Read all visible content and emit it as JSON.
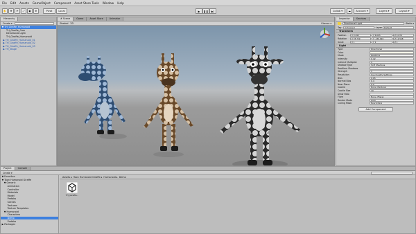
{
  "menu": [
    "File",
    "Edit",
    "Assets",
    "GameObject",
    "Component",
    "Asset Store Tools",
    "Window",
    "Help"
  ],
  "toolbar": {
    "pivot": "Pivot",
    "local": "Local",
    "play": "▶",
    "pause": "❚❚",
    "step": "▶|",
    "collab": "Collab ▾",
    "account": "Account ▾",
    "layers": "Layers ▾",
    "layout": "Layout ▾"
  },
  "hierarchy": {
    "tab": "Hierarchy",
    "create": "Create ▾",
    "rows": [
      {
        "text": "▼ TH_Giraffe_Humanoid",
        "indent": 1,
        "style": "sel"
      },
      {
        "text": "TH_Giraffe_Cam",
        "indent": 5,
        "style": ""
      },
      {
        "text": "Directional Light",
        "indent": 5,
        "style": ""
      },
      {
        "text": "TH_Giraffe_Humanoid",
        "indent": 5,
        "style": ""
      },
      {
        "text": "▶ TH_Giraffe_Humanoid_01",
        "indent": 2,
        "style": "blue"
      },
      {
        "text": "▶ TH_Giraffe_Humanoid_02",
        "indent": 2,
        "style": "blue"
      },
      {
        "text": "▶ TH_Giraffe_Humanoid_03",
        "indent": 2,
        "style": "blue"
      },
      {
        "text": "▶ TH_Stage",
        "indent": 2,
        "style": "blue"
      }
    ]
  },
  "scene": {
    "tabs": [
      "# Scene",
      "Game",
      "Asset Store",
      "Animator"
    ],
    "shaded": "Shaded",
    "mode_2d": "2D",
    "gizmos": "Gizmos ▾"
  },
  "inspector": {
    "tabs": [
      "Inspector",
      "Services"
    ],
    "object_name": "Directional Light",
    "static": "Static ▾",
    "tag": "Untagged",
    "layer": "Default",
    "transform_header": "Transform",
    "position": [
      "X 9.495",
      "Y 6.095",
      "Z 4.879"
    ],
    "rotation": [
      "X 35.729",
      "Y -130.094",
      "Z 12.548"
    ],
    "scale": [
      "X 1",
      "Y 1",
      "Z 1"
    ],
    "light_header": "Light",
    "rows": [
      {
        "label": "Type",
        "value": "Directional"
      },
      {
        "label": "Color",
        "value": ""
      },
      {
        "label": "Mode",
        "value": "Realtime"
      },
      {
        "label": "Intensity",
        "value": "0.42"
      },
      {
        "label": "Indirect Multiplier",
        "value": "1"
      },
      {
        "label": "Shadow Type",
        "value": "Soft Shadows"
      },
      {
        "label": "Realtime Shadows",
        "value": ""
      },
      {
        "label": "Strength",
        "value": "1"
      },
      {
        "label": "Resolution",
        "value": "Use Quality Settings"
      },
      {
        "label": "Bias",
        "value": "0.05"
      },
      {
        "label": "Normal Bias",
        "value": "0.4"
      },
      {
        "label": "Near Plane",
        "value": "0.2"
      },
      {
        "label": "Cookie",
        "value": "None (Texture)"
      },
      {
        "label": "Cookie Size",
        "value": "10"
      },
      {
        "label": "Draw Halo",
        "value": ""
      },
      {
        "label": "Flare",
        "value": "None (Flare)"
      },
      {
        "label": "Render Mode",
        "value": "Auto"
      },
      {
        "label": "Culling Mask",
        "value": "Everything"
      }
    ],
    "add_component": "Add Component"
  },
  "project": {
    "tabs": [
      "Project",
      "Console"
    ],
    "create": "Create ▾",
    "breadcrumbs": [
      "Assets ▸",
      "Toon Humanoid Giraffe ▸",
      "Humanoid ▸",
      "Demo"
    ],
    "tree": [
      {
        "text": "▼ Favorites",
        "indent": 1
      },
      {
        "text": "▼ Toon Humanoid Giraffe",
        "indent": 1
      },
      {
        "text": "▼ Generic",
        "indent": 3
      },
      {
        "text": "Animation",
        "indent": 6
      },
      {
        "text": "Controller",
        "indent": 6
      },
      {
        "text": "Materials",
        "indent": 6
      },
      {
        "text": "Model",
        "indent": 6
      },
      {
        "text": "Prefabs",
        "indent": 6
      },
      {
        "text": "Scenes",
        "indent": 6
      },
      {
        "text": "Textures",
        "indent": 6
      },
      {
        "text": "Texture Templates",
        "indent": 6
      },
      {
        "text": "▼ Humanoid",
        "indent": 3
      },
      {
        "text": "Characters",
        "indent": 6
      },
      {
        "text": "Demo",
        "indent": 6
      },
      {
        "text": "Prefabs",
        "indent": 6
      },
      {
        "text": "▶ Packages",
        "indent": 1
      }
    ],
    "asset_label": "TH_Giraffe..."
  }
}
